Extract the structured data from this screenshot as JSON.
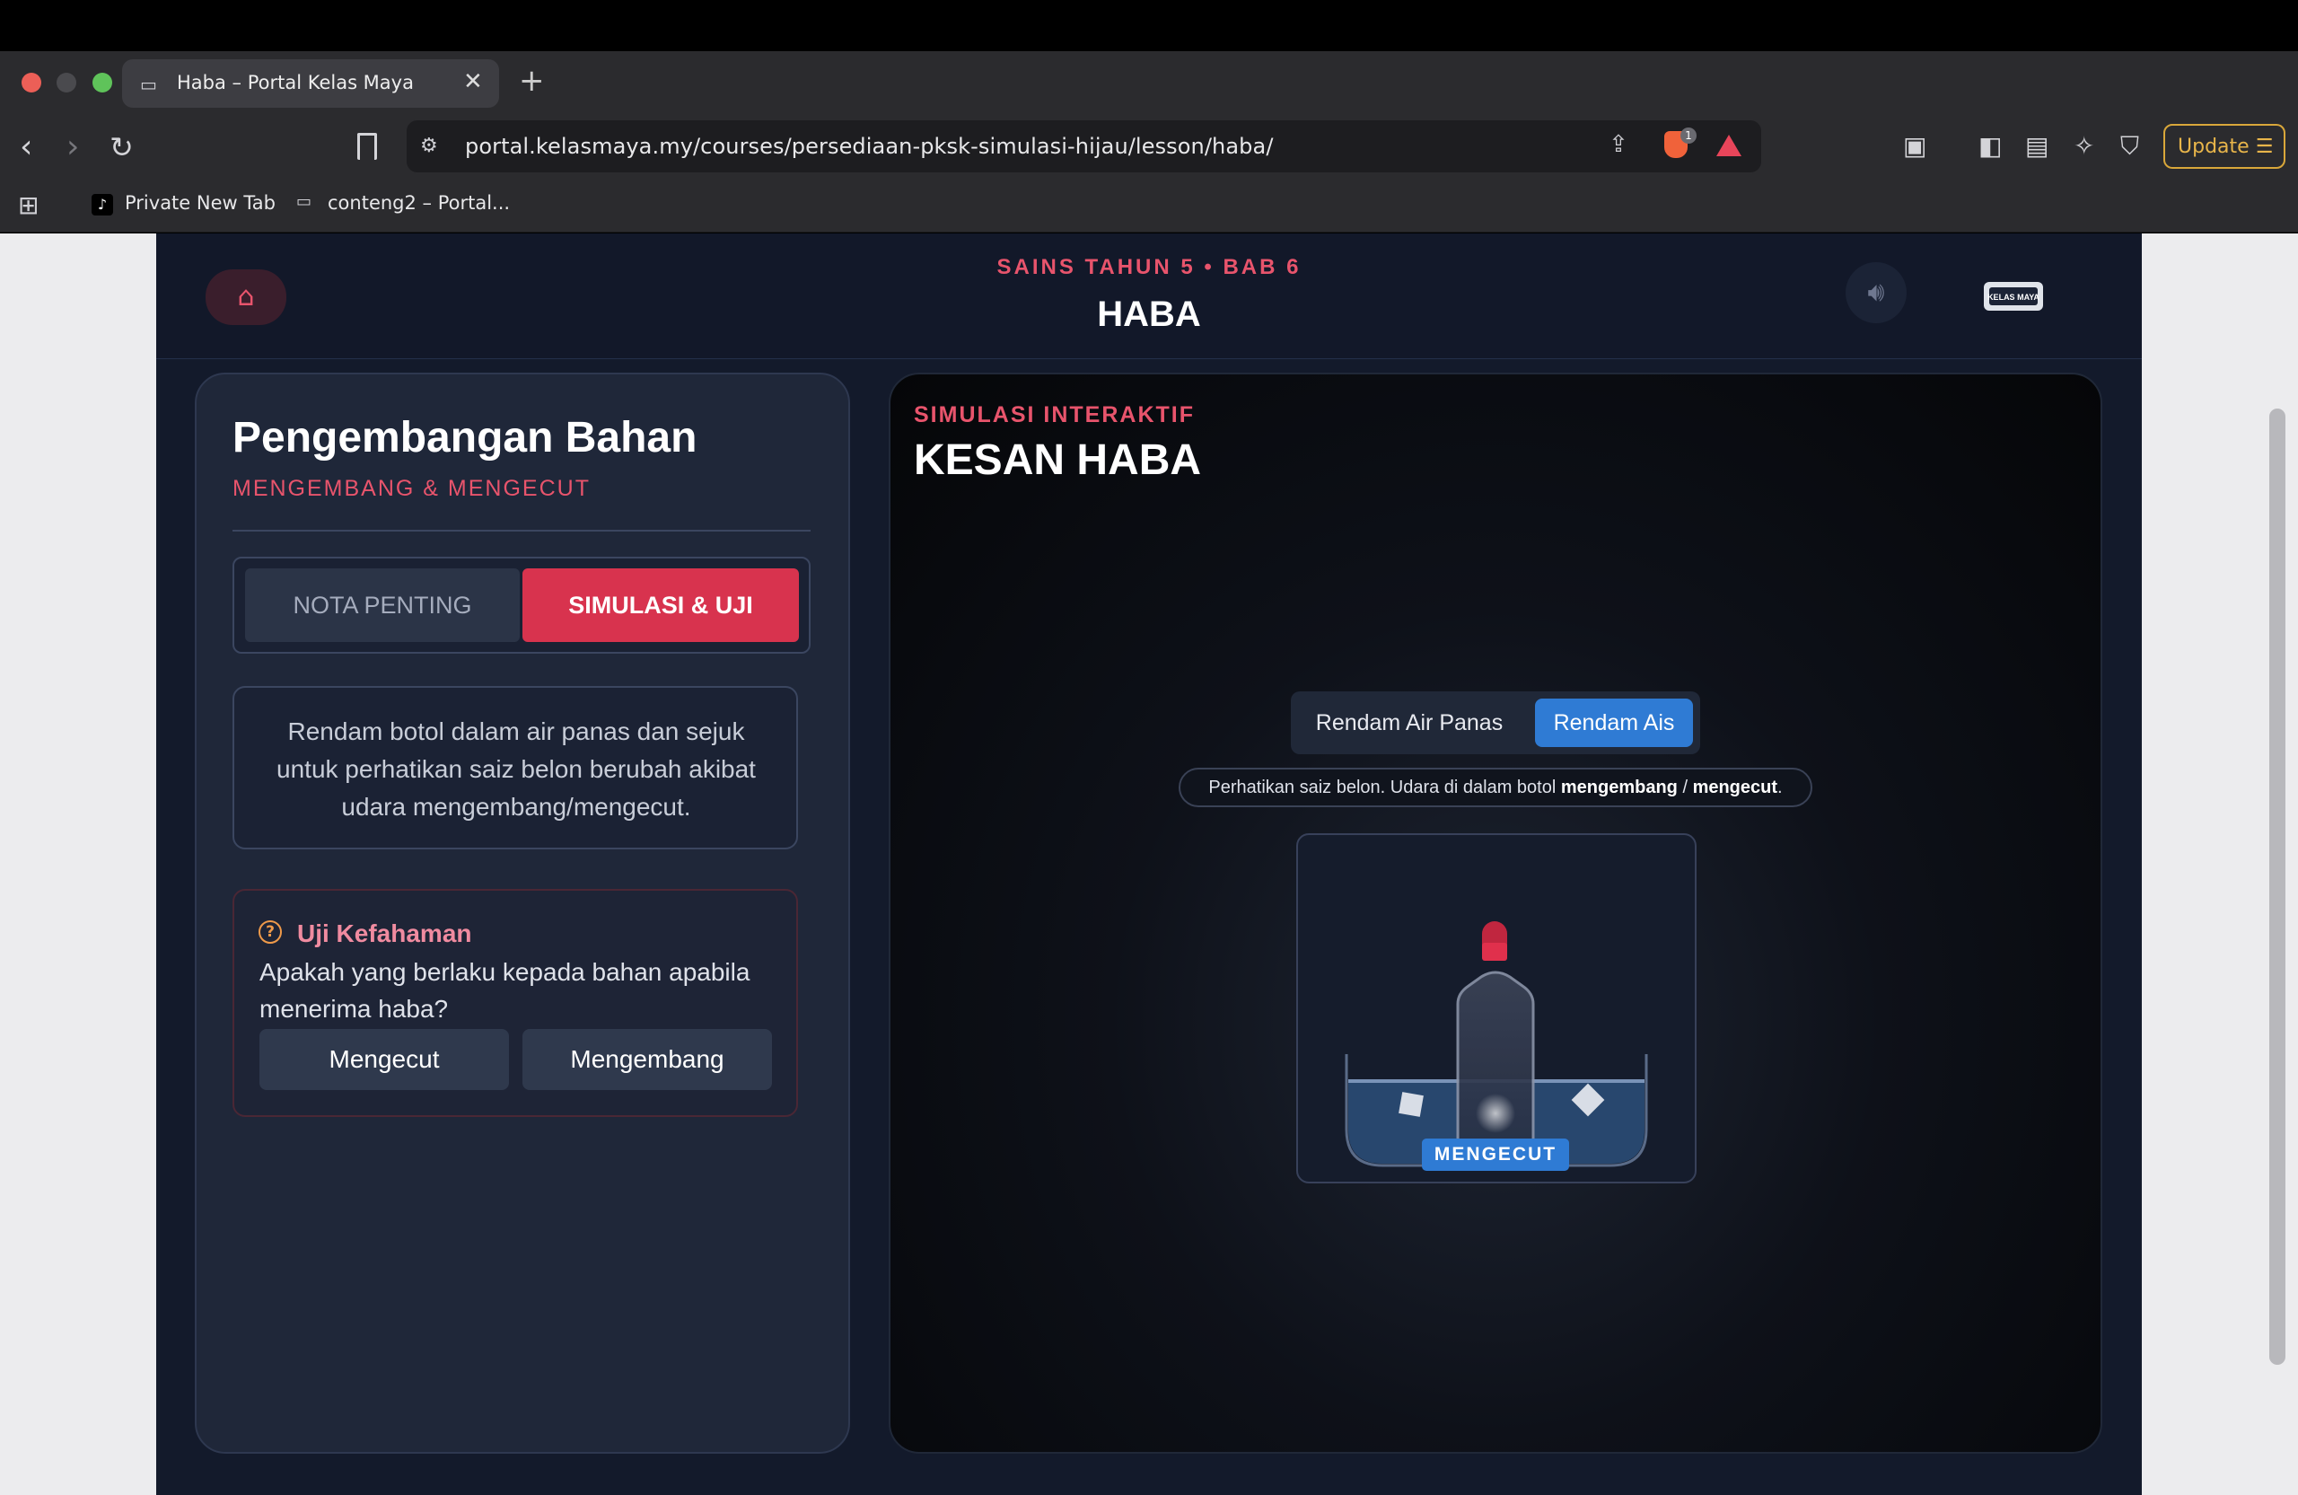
{
  "browser": {
    "tab_title": "Haba – Portal Kelas Maya",
    "new_tab_label": "+",
    "close_label": "✕",
    "url": "portal.kelasmaya.my/courses/persediaan-pksk-simulasi-hijau/lesson/haba/",
    "shield_badge": "1",
    "update_label": "Update",
    "bookmarks": [
      "Private New Tab",
      "conteng2 – Portal..."
    ]
  },
  "header": {
    "subtitle": "SAINS TAHUN 5 • BAB 6",
    "title": "HABA",
    "logo_text": "KELAS MAYA"
  },
  "left_panel": {
    "title": "Pengembangan Bahan",
    "subtitle": "MENGEMBANG & MENGECUT",
    "tabs": [
      "NOTA PENTING",
      "SIMULASI & UJI"
    ],
    "active_tab": "SIMULASI & UJI",
    "instruction": "Rendam botol dalam air panas dan sejuk untuk perhatikan saiz belon berubah akibat udara mengembang/mengecut.",
    "quiz": {
      "title": "Uji Kefahaman",
      "question": "Apakah yang berlaku kepada bahan apabila menerima haba?",
      "options": [
        "Mengecut",
        "Mengembang"
      ]
    }
  },
  "right_panel": {
    "subtitle": "SIMULASI INTERAKTIF",
    "title": "KESAN HABA",
    "modes": [
      "Rendam Air Panas",
      "Rendam Ais"
    ],
    "active_mode": "Rendam Ais",
    "hint_prefix": "Perhatikan saiz belon. Udara di dalam botol ",
    "hint_bold1": "mengembang",
    "hint_sep": " / ",
    "hint_bold2": "mengecut",
    "hint_suffix": ".",
    "state_label": "MENGECUT"
  },
  "colors": {
    "accent_red": "#d8334e",
    "accent_pink": "#e8546c",
    "accent_blue": "#2f7bd4",
    "panel_bg": "#1f2739"
  },
  "icons": [
    "home-icon",
    "sound-icon",
    "question-icon",
    "back-icon",
    "forward-icon",
    "reload-icon",
    "bookmark-icon"
  ]
}
